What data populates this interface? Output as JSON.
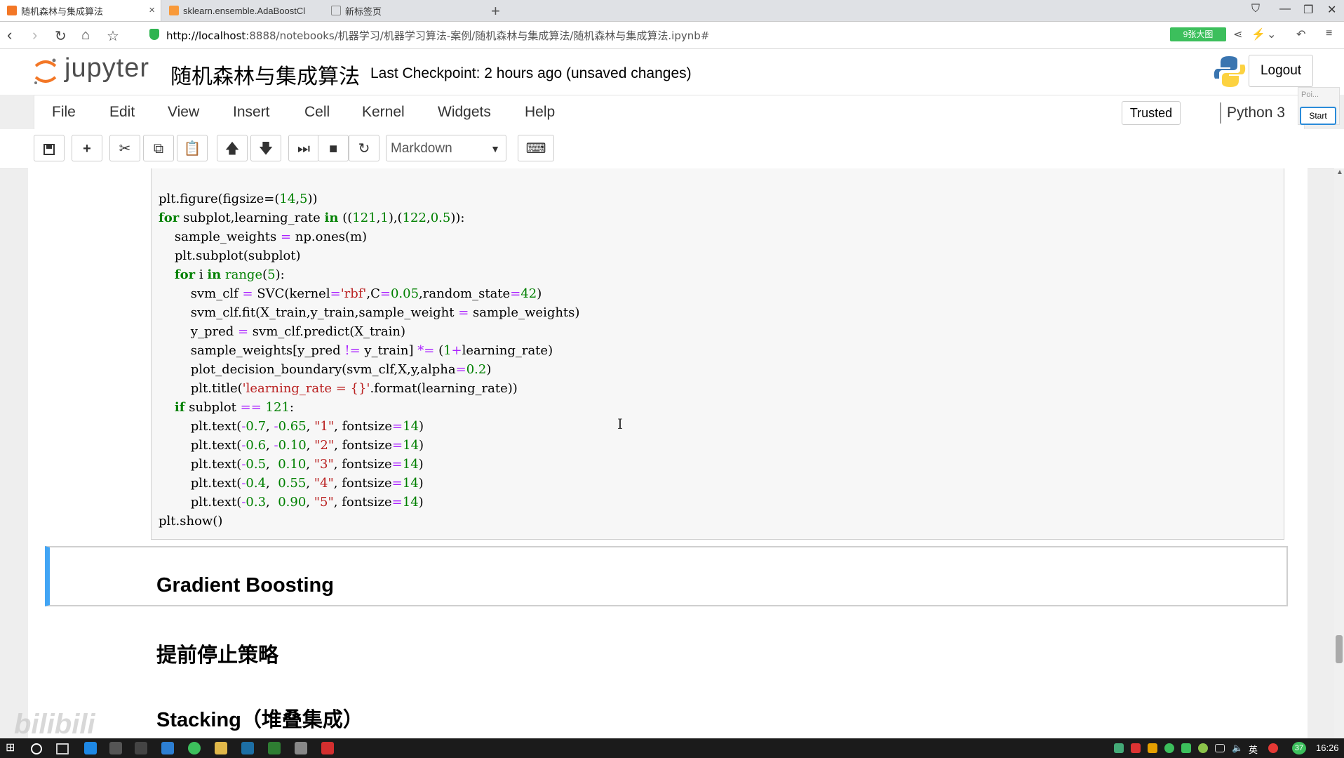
{
  "browser": {
    "tabs": [
      {
        "label": "随机森林与集成算法",
        "active": true
      },
      {
        "label": "sklearn.ensemble.AdaBoostCl",
        "active": false
      },
      {
        "label": "新标签页",
        "active": false
      }
    ],
    "url_host": "http://localhost",
    "url_rest": ":8888/notebooks/机器学习/机器学习算法-案例/随机森林与集成算法/随机森林与集成算法.ipynb#",
    "badge": "9张大图"
  },
  "jupyter": {
    "logo_text": "jupyter",
    "notebook_name": "随机森林与集成算法",
    "checkpoint": "Last Checkpoint: 2 hours ago (unsaved changes)",
    "logout": "Logout",
    "menu": [
      "File",
      "Edit",
      "View",
      "Insert",
      "Cell",
      "Kernel",
      "Widgets",
      "Help"
    ],
    "trusted": "Trusted",
    "kernel": "Python 3",
    "popup_label": "Poi...",
    "start": "Start",
    "cell_type": "Markdown"
  },
  "toolbar": {
    "icons": [
      "save-icon",
      "plus-icon",
      "cut-icon",
      "copy-icon",
      "paste-icon",
      "arrow-up-icon",
      "arrow-down-icon",
      "run-icon",
      "stop-icon",
      "restart-icon",
      "keyboard-icon"
    ]
  },
  "notebook": {
    "code_lines": [
      "plt.figure(figsize=(14,5))",
      "for subplot,learning_rate in ((121,1),(122,0.5)):",
      "    sample_weights = np.ones(m)",
      "    plt.subplot(subplot)",
      "    for i in range(5):",
      "        svm_clf = SVC(kernel='rbf',C=0.05,random_state=42)",
      "        svm_clf.fit(X_train,y_train,sample_weight = sample_weights)",
      "        y_pred = svm_clf.predict(X_train)",
      "        sample_weights[y_pred != y_train] *= (1+learning_rate)",
      "        plot_decision_boundary(svm_clf,X,y,alpha=0.2)",
      "        plt.title('learning_rate = {}'.format(learning_rate))",
      "    if subplot == 121:",
      "        plt.text(-0.7, -0.65, \"1\", fontsize=14)",
      "        plt.text(-0.6, -0.10, \"2\", fontsize=14)",
      "        plt.text(-0.5,  0.10, \"3\", fontsize=14)",
      "        plt.text(-0.4,  0.55, \"4\", fontsize=14)",
      "        plt.text(-0.3,  0.90, \"5\", fontsize=14)",
      "plt.show()"
    ],
    "heading_gradient": "Gradient Boosting",
    "heading_early_stop": "提前停止策略",
    "heading_stacking": "Stacking（堆叠集成）",
    "watermark": "bilibili"
  },
  "taskbar": {
    "lang": "英",
    "badge": "37",
    "time": "16:26"
  }
}
